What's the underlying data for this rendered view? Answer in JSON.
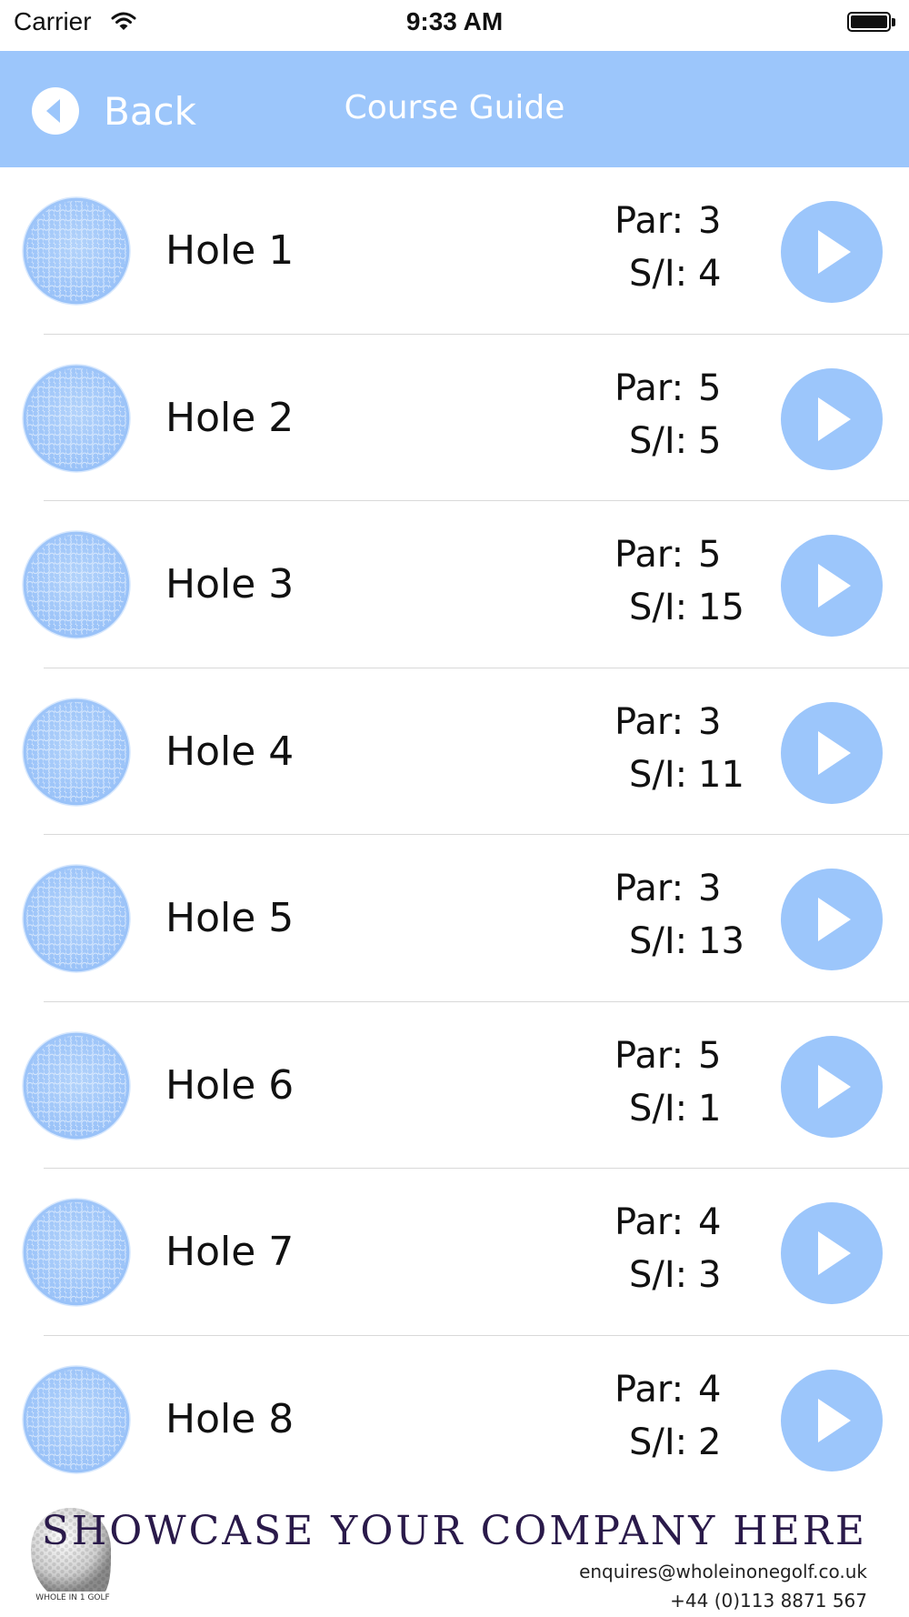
{
  "status_bar": {
    "carrier": "Carrier",
    "time": "9:33 AM"
  },
  "nav": {
    "back_label": "Back",
    "title": "Course Guide"
  },
  "labels": {
    "par": "Par:",
    "si": "S/I:"
  },
  "holes": [
    {
      "name": "Hole 1",
      "par": "3",
      "si": "4"
    },
    {
      "name": "Hole 2",
      "par": "5",
      "si": "5"
    },
    {
      "name": "Hole 3",
      "par": "5",
      "si": "15"
    },
    {
      "name": "Hole 4",
      "par": "3",
      "si": "11"
    },
    {
      "name": "Hole 5",
      "par": "3",
      "si": "13"
    },
    {
      "name": "Hole 6",
      "par": "5",
      "si": "1"
    },
    {
      "name": "Hole 7",
      "par": "4",
      "si": "3"
    },
    {
      "name": "Hole 8",
      "par": "4",
      "si": "2"
    }
  ],
  "footer": {
    "headline": "SHOWCASE YOUR COMPANY HERE",
    "email": "enquires@wholeinonegolf.co.uk",
    "phone": "+44 (0)113 8871 567",
    "logo_text": "WHOLE IN 1 GOLF"
  },
  "colors": {
    "accent": "#9cc6fb",
    "ball": "#a3c9fa",
    "text": "#111111"
  },
  "icons": {
    "back": "back-circle-icon",
    "ball": "golf-ball-icon",
    "play": "play-icon"
  }
}
